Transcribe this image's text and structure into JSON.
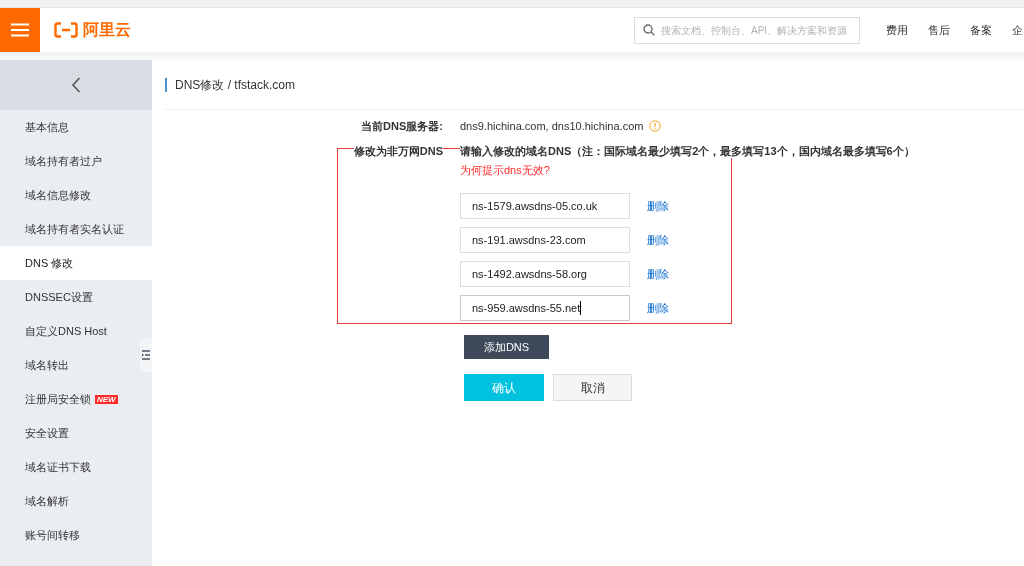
{
  "header": {
    "logo_text": "阿里云",
    "search": {
      "placeholder": "搜索文档、控制台、API、解决方案和资源"
    },
    "nav": [
      "费用",
      "售后",
      "备案",
      "企"
    ]
  },
  "sidebar": {
    "items": [
      {
        "label": "基本信息",
        "selected": false
      },
      {
        "label": "域名持有者过户",
        "selected": false
      },
      {
        "label": "域名信息修改",
        "selected": false
      },
      {
        "label": "域名持有者实名认证",
        "selected": false
      },
      {
        "label": "DNS 修改",
        "selected": true
      },
      {
        "label": "DNSSEC设置",
        "selected": false
      },
      {
        "label": "自定义DNS Host",
        "selected": false
      },
      {
        "label": "域名转出",
        "selected": false
      },
      {
        "label": "注册局安全锁",
        "selected": false,
        "badge": "NEW"
      },
      {
        "label": "安全设置",
        "selected": false
      },
      {
        "label": "域名证书下载",
        "selected": false
      },
      {
        "label": "域名解析",
        "selected": false
      },
      {
        "label": "账号间转移",
        "selected": false
      }
    ]
  },
  "breadcrumb": "DNS修改 / tfstack.com",
  "form": {
    "current_dns": {
      "label": "当前DNS服务器:",
      "value": "dns9.hichina.com, dns10.hichina.com"
    },
    "change": {
      "label": "修改为非万网DNS",
      "hint": "请输入修改的域名DNS（注：国际域名最少填写2个，最多填写13个，国内域名最多填写6个）",
      "help_link": "为何提示dns无效?"
    },
    "dns_entries": [
      {
        "value": "ns-1579.awsdns-05.co.uk",
        "focused": false,
        "delete_label": "删除"
      },
      {
        "value": "ns-191.awsdns-23.com",
        "focused": false,
        "delete_label": "删除"
      },
      {
        "value": "ns-1492.awsdns-58.org",
        "focused": false,
        "delete_label": "删除"
      },
      {
        "value": "ns-959.awsdns-55.net",
        "focused": true,
        "delete_label": "删除"
      }
    ],
    "add_button": "添加DNS",
    "confirm_button": "确认",
    "cancel_button": "取消"
  }
}
